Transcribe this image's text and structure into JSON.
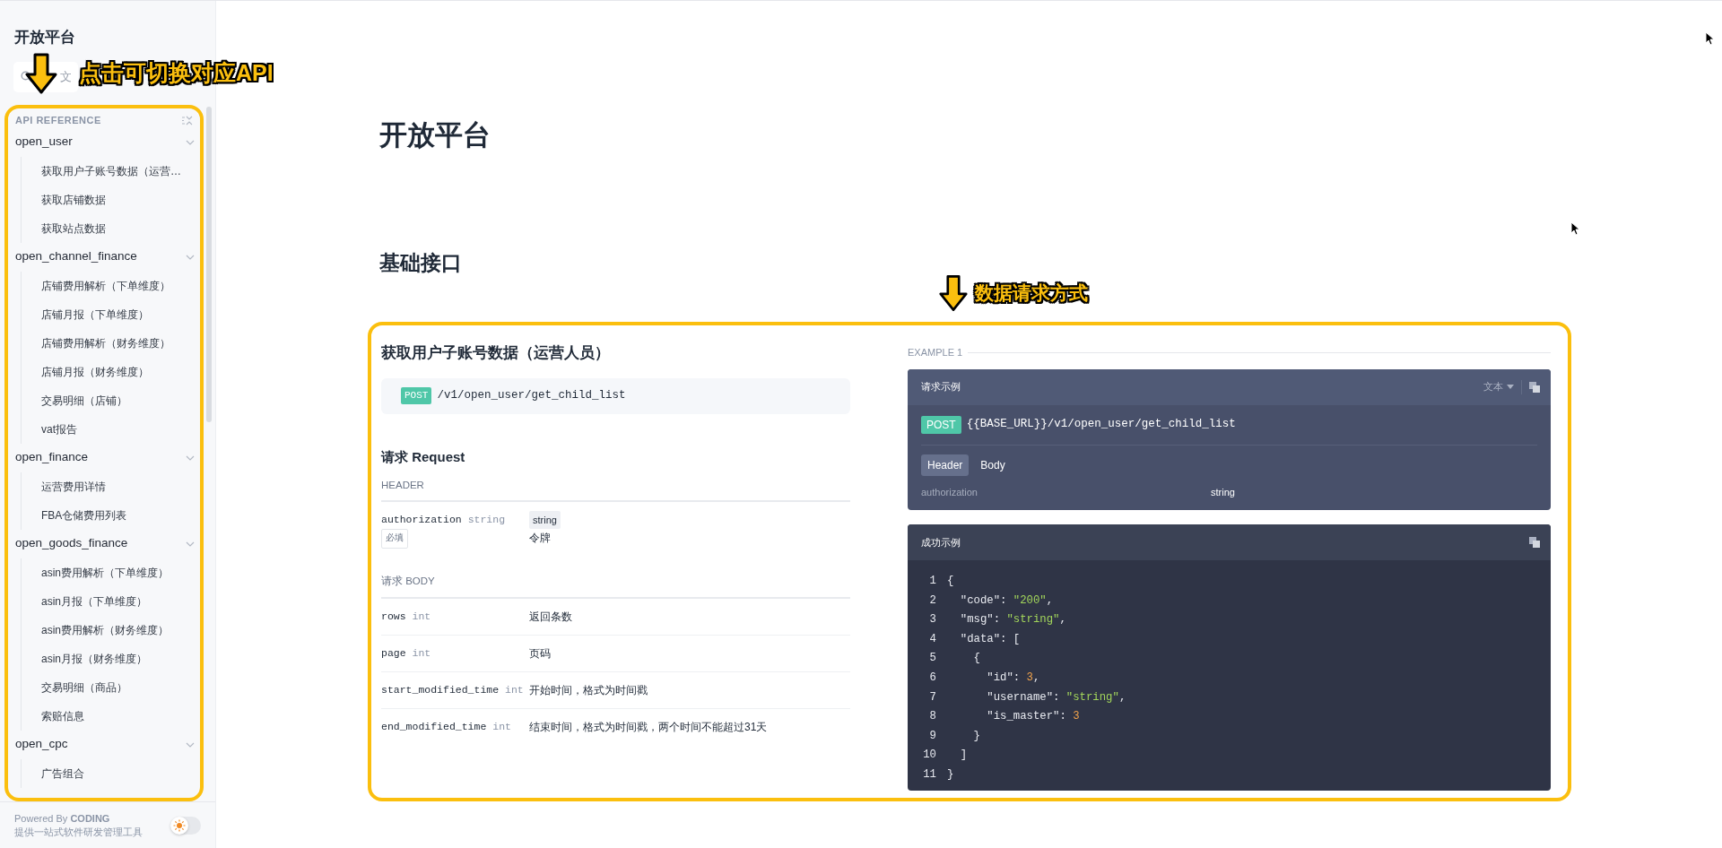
{
  "sidebar": {
    "title": "开放平台",
    "search": {
      "placeholder": "文"
    },
    "section_label": "API REFERENCE",
    "groups": [
      {
        "label": "open_user",
        "expanded": true,
        "children": [
          {
            "label": "获取用户子账号数据（运营…",
            "selected": false
          },
          {
            "label": "获取店铺数据",
            "selected": false
          },
          {
            "label": "获取站点数据",
            "selected": false
          }
        ]
      },
      {
        "label": "open_channel_finance",
        "expanded": true,
        "children": [
          {
            "label": "店铺费用解析（下单维度）",
            "selected": false
          },
          {
            "label": "店铺月报（下单维度）",
            "selected": false
          },
          {
            "label": "店铺费用解析（财务维度）",
            "selected": false
          },
          {
            "label": "店铺月报（财务维度）",
            "selected": false
          },
          {
            "label": "交易明细（店铺）",
            "selected": false
          },
          {
            "label": "vat报告",
            "selected": false
          }
        ]
      },
      {
        "label": "open_finance",
        "expanded": true,
        "children": [
          {
            "label": "运营费用详情",
            "selected": false
          },
          {
            "label": "FBA仓储费用列表",
            "selected": false
          }
        ]
      },
      {
        "label": "open_goods_finance",
        "expanded": true,
        "children": [
          {
            "label": "asin费用解析（下单维度）",
            "selected": false
          },
          {
            "label": "asin月报（下单维度）",
            "selected": false
          },
          {
            "label": "asin费用解析（财务维度）",
            "selected": false
          },
          {
            "label": "asin月报（财务维度）",
            "selected": false
          },
          {
            "label": "交易明细（商品）",
            "selected": false
          },
          {
            "label": "索赔信息",
            "selected": false
          }
        ]
      },
      {
        "label": "open_cpc",
        "expanded": true,
        "children": [
          {
            "label": "广告组合",
            "selected": false
          }
        ]
      }
    ],
    "footer": {
      "powered_by": "Powered By **CODING**",
      "tagline": "提供一站式软件研发管理工具",
      "dark_mode": false
    }
  },
  "main": {
    "page_title": "开放平台",
    "section_title": "基础接口",
    "endpoint": {
      "title": "获取用户子账号数据（运营人员）",
      "method": "POST",
      "path": "/v1/open_user/get_child_list",
      "request": {
        "heading": "请求 Request",
        "header_label": "HEADER",
        "header_params": [
          {
            "name": "authorization",
            "type": "string",
            "required_label": "必填",
            "type_tag": "string",
            "description": "令牌"
          }
        ],
        "body_label": "请求 BODY",
        "body_params": [
          {
            "name": "rows",
            "type": "int",
            "description": "返回条数"
          },
          {
            "name": "page",
            "type": "int",
            "description": "页码"
          },
          {
            "name": "start_modified_time",
            "type": "int",
            "description": "开始时间，格式为时间戳"
          },
          {
            "name": "end_modified_time",
            "type": "int",
            "description": "结束时间，格式为时间戳，两个时间不能超过31天"
          }
        ]
      },
      "example": {
        "label": "EXAMPLE 1",
        "request_card": {
          "title": "请求示例",
          "format": "文本",
          "method": "POST",
          "url": "{{BASE_URL}}/v1/open_user/get_child_list",
          "tabs": [
            {
              "label": "Header",
              "selected": true
            },
            {
              "label": "Body",
              "selected": false
            }
          ],
          "params": [
            {
              "name": "authorization",
              "value": "string"
            }
          ]
        },
        "response_card": {
          "title": "成功示例",
          "lines": [
            {
              "number": "1",
              "tokens": [
                {
                  "kind": "plain",
                  "text": "{"
                }
              ]
            },
            {
              "number": "2",
              "tokens": [
                {
                  "kind": "plain",
                  "text": "  \"code\": "
                },
                {
                  "kind": "string",
                  "text": "\"200\""
                },
                {
                  "kind": "plain",
                  "text": ","
                }
              ]
            },
            {
              "number": "3",
              "tokens": [
                {
                  "kind": "plain",
                  "text": "  \"msg\": "
                },
                {
                  "kind": "string",
                  "text": "\"string\""
                },
                {
                  "kind": "plain",
                  "text": ","
                }
              ]
            },
            {
              "number": "4",
              "tokens": [
                {
                  "kind": "plain",
                  "text": "  \"data\": ["
                }
              ]
            },
            {
              "number": "5",
              "tokens": [
                {
                  "kind": "plain",
                  "text": "    {"
                }
              ]
            },
            {
              "number": "6",
              "tokens": [
                {
                  "kind": "plain",
                  "text": "      \"id\": "
                },
                {
                  "kind": "number",
                  "text": "3"
                },
                {
                  "kind": "plain",
                  "text": ","
                }
              ]
            },
            {
              "number": "7",
              "tokens": [
                {
                  "kind": "plain",
                  "text": "      \"username\": "
                },
                {
                  "kind": "string",
                  "text": "\"string\""
                },
                {
                  "kind": "plain",
                  "text": ","
                }
              ]
            },
            {
              "number": "8",
              "tokens": [
                {
                  "kind": "plain",
                  "text": "      \"is_master\": "
                },
                {
                  "kind": "number",
                  "text": "3"
                }
              ]
            },
            {
              "number": "9",
              "tokens": [
                {
                  "kind": "plain",
                  "text": "    }"
                }
              ]
            },
            {
              "number": "10",
              "tokens": [
                {
                  "kind": "plain",
                  "text": "  ]"
                }
              ]
            },
            {
              "number": "11",
              "tokens": [
                {
                  "kind": "plain",
                  "text": "}"
                }
              ]
            }
          ]
        }
      }
    }
  },
  "annotations": [
    {
      "text": "点击可切换对应API"
    },
    {
      "text": "数据请求方式"
    }
  ]
}
